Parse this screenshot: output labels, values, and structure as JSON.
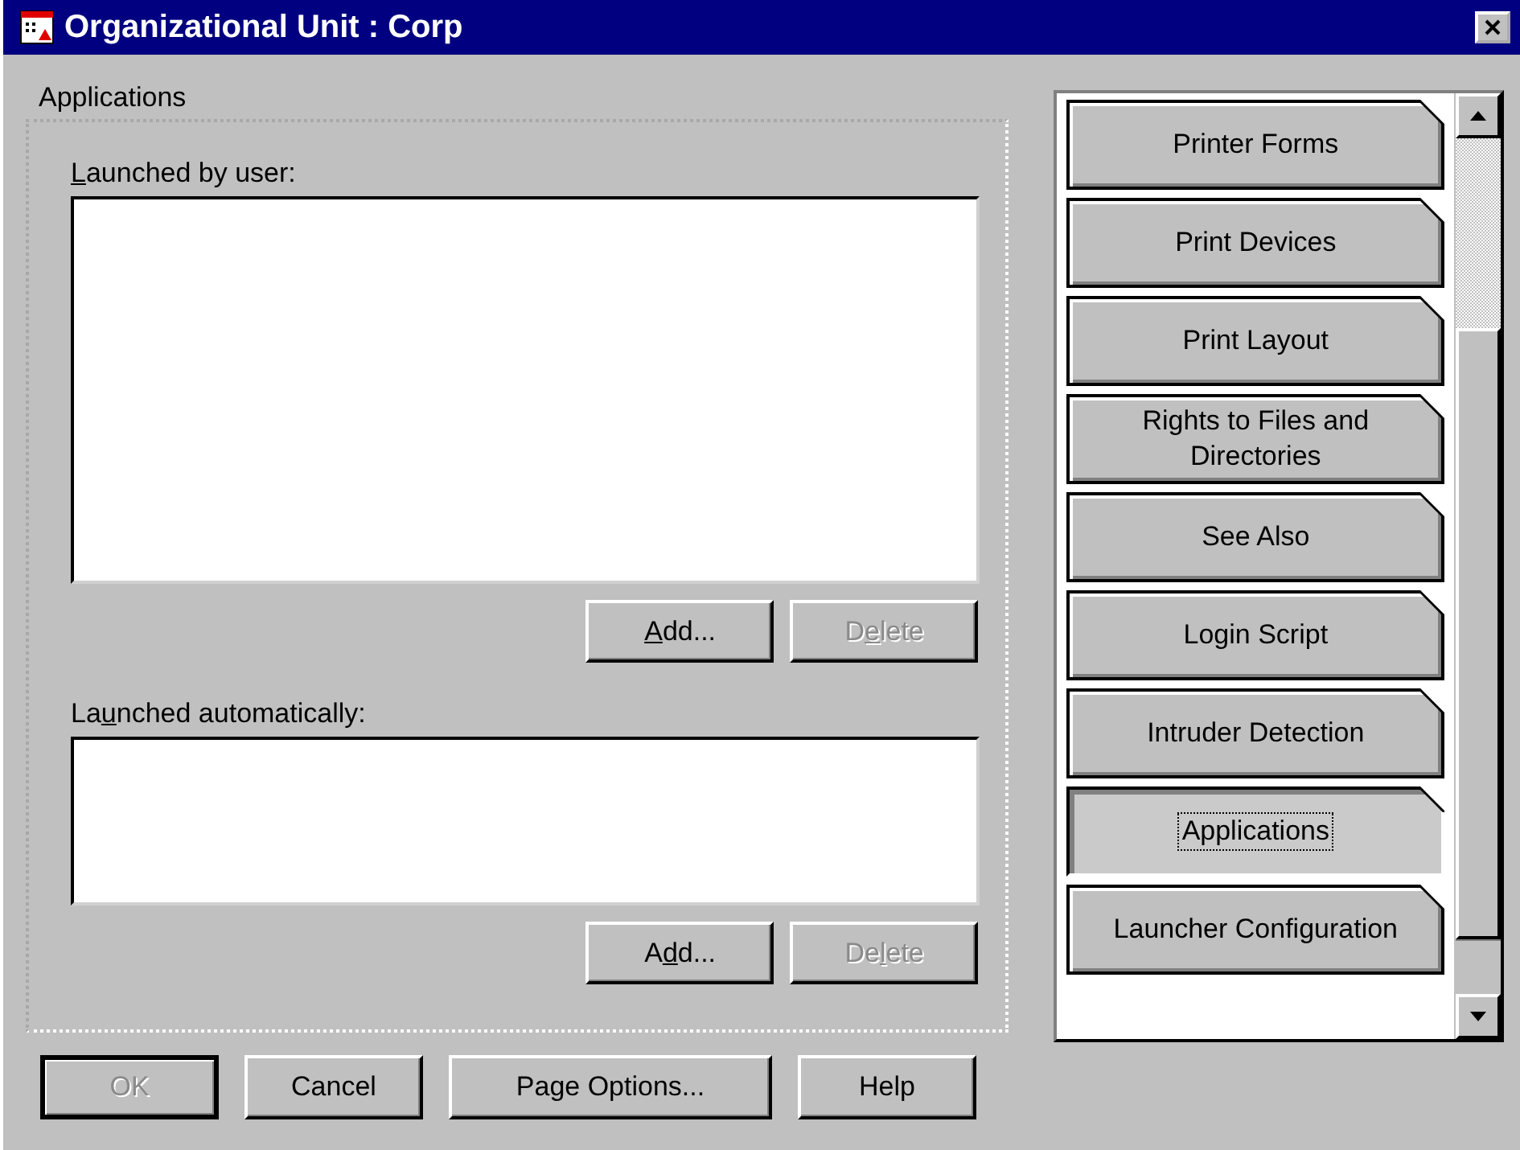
{
  "window": {
    "title": "Organizational Unit : Corp"
  },
  "page": {
    "title": "Applications",
    "sections": [
      {
        "label": {
          "key": "L",
          "post": "aunched by user:"
        },
        "buttons": [
          {
            "label": {
              "key": "A",
              "post": "dd..."
            },
            "disabled": false
          },
          {
            "label": {
              "pre": "D",
              "key": "e",
              "post": "lete"
            },
            "disabled": true
          }
        ]
      },
      {
        "label": {
          "pre": "La",
          "key": "u",
          "post": "nched automatically:"
        },
        "buttons": [
          {
            "label": {
              "pre": "A",
              "key": "d",
              "post": "d..."
            },
            "disabled": false
          },
          {
            "label": {
              "pre": "De",
              "key": "l",
              "post": "ete"
            },
            "disabled": true
          }
        ]
      }
    ]
  },
  "page_tabs": [
    {
      "label": "Printer Forms",
      "selected": false
    },
    {
      "label": "Print Devices",
      "selected": false
    },
    {
      "label": "Print Layout",
      "selected": false
    },
    {
      "label": "Rights to Files and Directories",
      "selected": false
    },
    {
      "label": "See Also",
      "selected": false
    },
    {
      "label": "Login Script",
      "selected": false
    },
    {
      "label": "Intruder Detection",
      "selected": false
    },
    {
      "label": "Applications",
      "selected": true
    },
    {
      "label": "Launcher Configuration",
      "selected": false
    }
  ],
  "buttons": [
    {
      "label": "OK",
      "disabled": true
    },
    {
      "label": "Cancel",
      "disabled": false
    },
    {
      "label": "Page Options...",
      "disabled": false
    },
    {
      "label": "Help",
      "disabled": false
    }
  ]
}
